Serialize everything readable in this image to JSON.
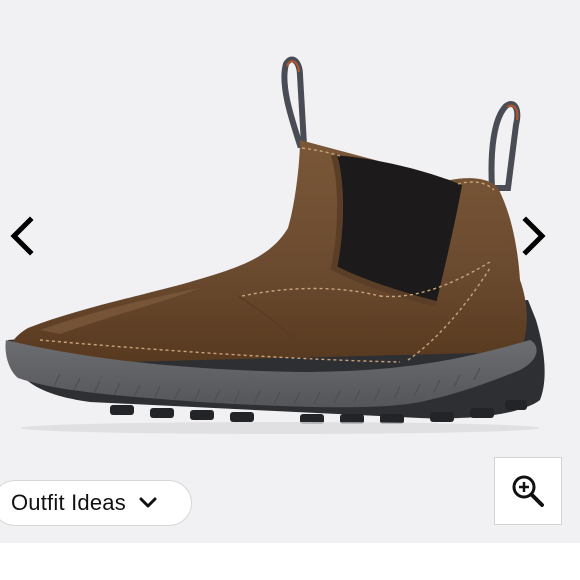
{
  "gallery": {
    "product_image_icon": "chelsea-boot-image",
    "prev_icon": "chevron-left-icon",
    "next_icon": "chevron-right-icon",
    "zoom_icon": "zoom-in-icon",
    "outfit_ideas": {
      "label": "Outfit Ideas",
      "icon": "chevron-down-icon"
    }
  },
  "colors": {
    "background": "#f1f0f2",
    "leather": "#6e4d32",
    "sole": "#5f6063",
    "elastic": "#1c1a1a"
  }
}
